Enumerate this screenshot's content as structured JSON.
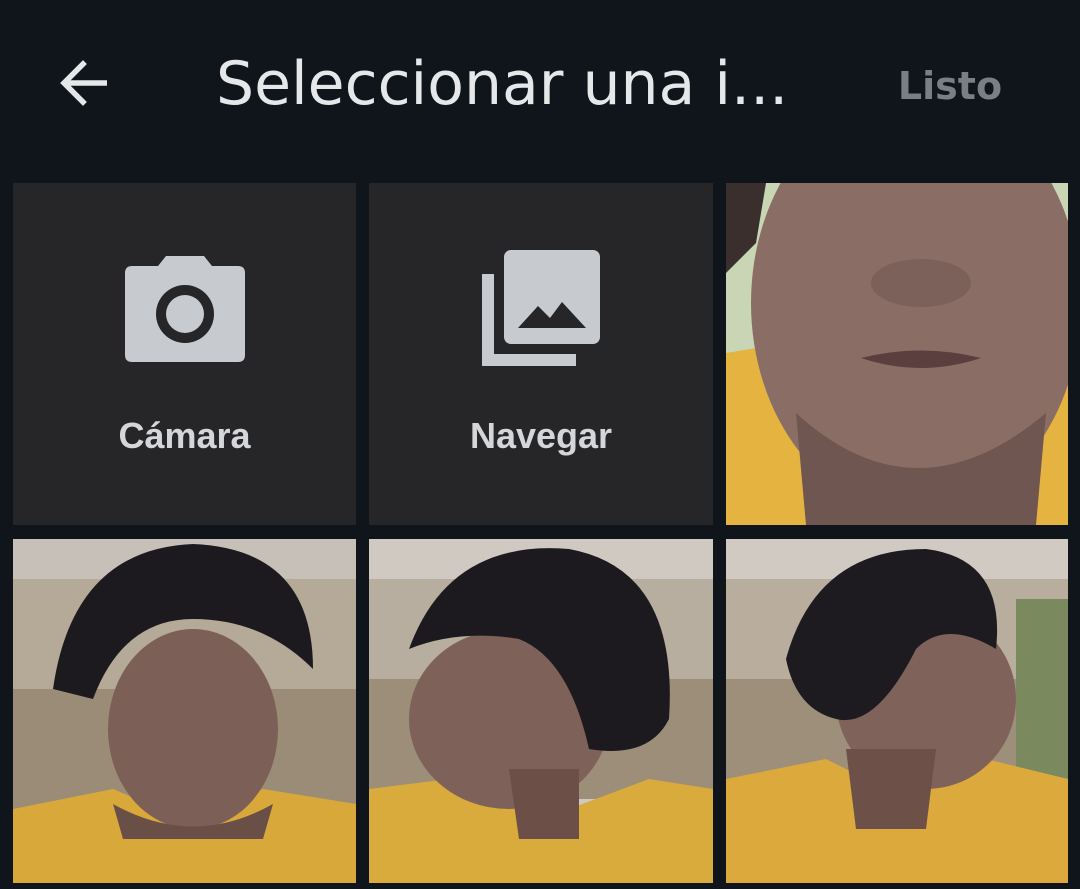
{
  "header": {
    "title": "Seleccionar una i...",
    "done_label": "Listo"
  },
  "actions": [
    {
      "label": "Cámara",
      "icon": "camera-icon"
    },
    {
      "label": "Navegar",
      "icon": "gallery-icon"
    }
  ],
  "colors": {
    "background": "#0f151b",
    "tile": "#262628",
    "icon": "#c7cacf",
    "title": "#e6e7e9",
    "done_disabled": "#7a7f86",
    "shirt": "#e8b93a"
  }
}
